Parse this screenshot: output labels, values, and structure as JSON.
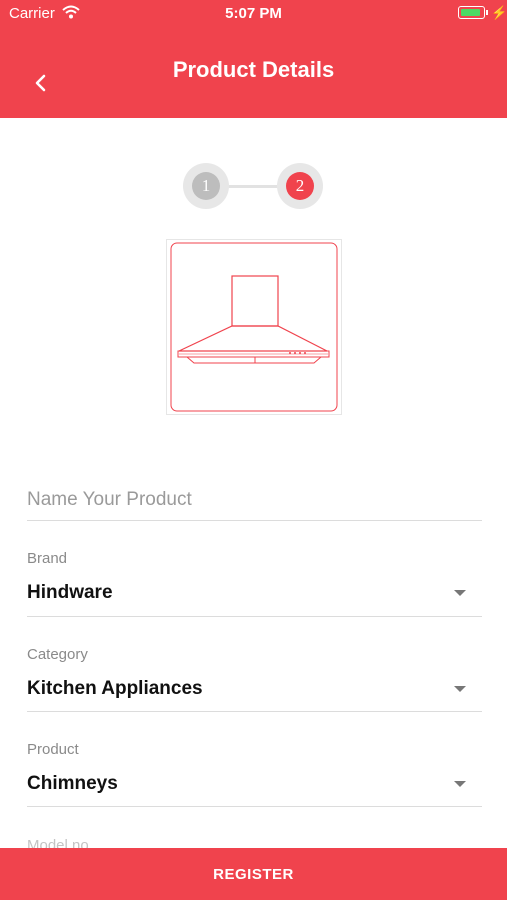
{
  "status_bar": {
    "carrier": "Carrier",
    "time": "5:07 PM"
  },
  "header": {
    "title": "Product Details",
    "color": "#f0434d"
  },
  "stepper": {
    "steps": [
      "1",
      "2"
    ],
    "active_step": 2
  },
  "form": {
    "name_field": {
      "placeholder": "Name Your Product",
      "value": ""
    },
    "brand": {
      "label": "Brand",
      "value": "Hindware"
    },
    "category": {
      "label": "Category",
      "value": "Kitchen Appliances"
    },
    "product": {
      "label": "Product",
      "value": "Chimneys"
    },
    "model_no": {
      "label": "Model no"
    }
  },
  "footer": {
    "register_label": "REGISTER"
  },
  "icons": [
    "wifi-icon",
    "battery-icon",
    "charging-icon",
    "back-arrow-icon",
    "chimney-icon",
    "dropdown-caret-icon"
  ]
}
